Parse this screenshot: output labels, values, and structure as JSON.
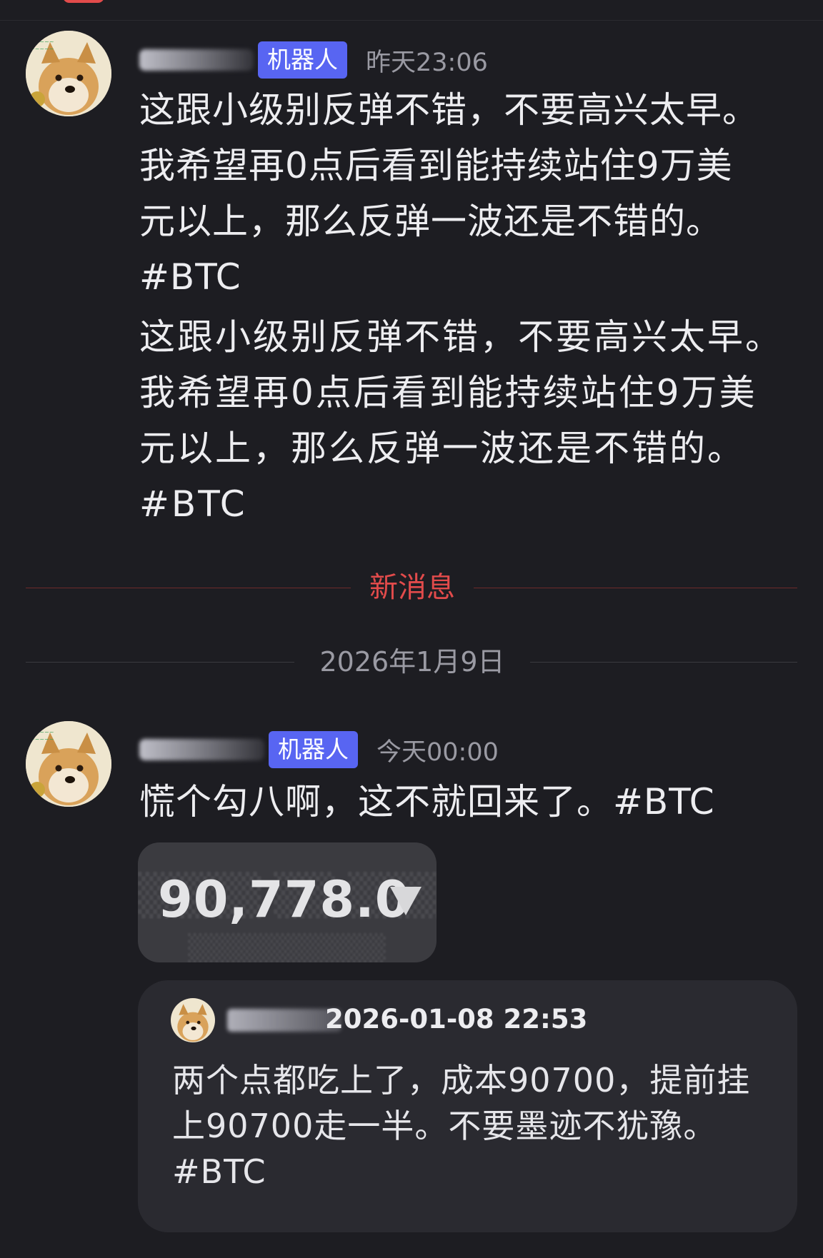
{
  "messages": [
    {
      "author_badge": "机器人",
      "time": "昨天23:06",
      "body_1": "这跟小级别反弹不错，不要高兴太早。\n我希望再0点后看到能持续站住9万美\n元以上，那么反弹一波还是不错的。\n#BTC",
      "body_2": "这跟小级别反弹不错，不要高兴太早。\n我希望再0点后看到能持续站住9万美\n元以上，那么反弹一波还是不错的。\n#BTC"
    },
    {
      "author_badge": "机器人",
      "time": "今天00:00",
      "body": "慌个勾八啊，这不就回来了。#BTC",
      "image_price": "90,778.0"
    }
  ],
  "new_messages_label": "新消息",
  "date_separator": "2026年1月9日",
  "quoted": {
    "time": "2026-01-08 22:53",
    "body": "两个点都吃上了，成本90700，提前挂\n上90700走一半。不要墨迹不犹豫。\n#BTC"
  },
  "colors": {
    "background": "#1d1d22",
    "bot_badge": "#5865f2",
    "new_messages_divider": "#e24b4b",
    "muted_text": "#9a9aa3"
  },
  "icons": {
    "avatar": "doge-avatar-icon",
    "price_direction": "triangle-down-icon"
  }
}
